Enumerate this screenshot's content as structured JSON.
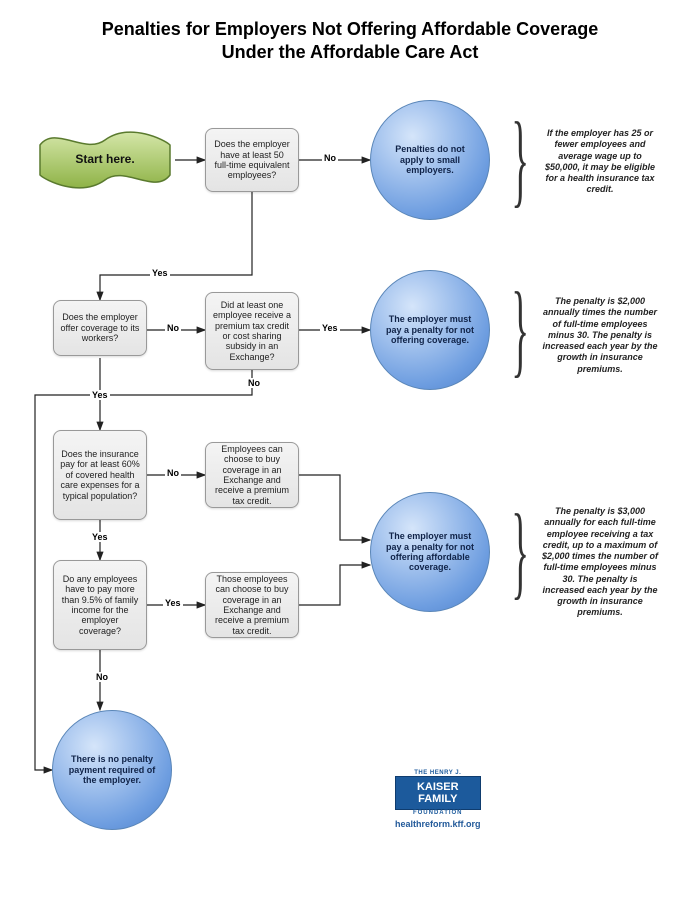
{
  "title_line1": "Penalties for Employers Not Offering Affordable Coverage",
  "title_line2": "Under the Affordable Care Act",
  "nodes": {
    "start": "Start here.",
    "q_50emp": "Does the employer have at least 50 full-time equivalent employees?",
    "r_small": "Penalties do not apply to small employers.",
    "q_offer": "Does the employer offer coverage to its workers?",
    "q_credit": "Did at least one employee receive a premium tax credit or cost sharing subsidy in an Exchange?",
    "r_notoffer": "The employer must pay a penalty for not offering coverage.",
    "q_60pct": "Does the insurance pay for at least 60% of covered health care expenses for a typical population?",
    "b_exch1": "Employees can choose to buy coverage in an Exchange and receive a premium tax credit.",
    "q_95pct": "Do any employees have to pay more than 9.5% of family income for the employer coverage?",
    "b_exch2": "Those employees can choose to buy coverage in an Exchange and receive a premium tax credit.",
    "r_notafford": "The employer must pay a penalty for not offering affordable coverage.",
    "r_nopenalty": "There is no penalty payment required of the employer."
  },
  "annotations": {
    "a1": "If the employer has 25 or fewer employees and average wage up to $50,000, it may be eligible for a health insurance tax credit.",
    "a2": "The penalty is $2,000 annually times the number of full-time employees minus 30. The penalty is increased each year by the growth in insurance premiums.",
    "a3": "The penalty is $3,000 annually for each full-time employee receiving a tax credit, up to a maximum of $2,000 times the number of full-time employees minus 30. The penalty is increased each year by the growth in insurance premiums."
  },
  "labels": {
    "yes": "Yes",
    "no": "No"
  },
  "logo": {
    "top": "THE HENRY J.",
    "l1": "KAISER",
    "l2": "FAMILY",
    "fnd": "FOUNDATION",
    "url": "healthreform.kff.org"
  }
}
